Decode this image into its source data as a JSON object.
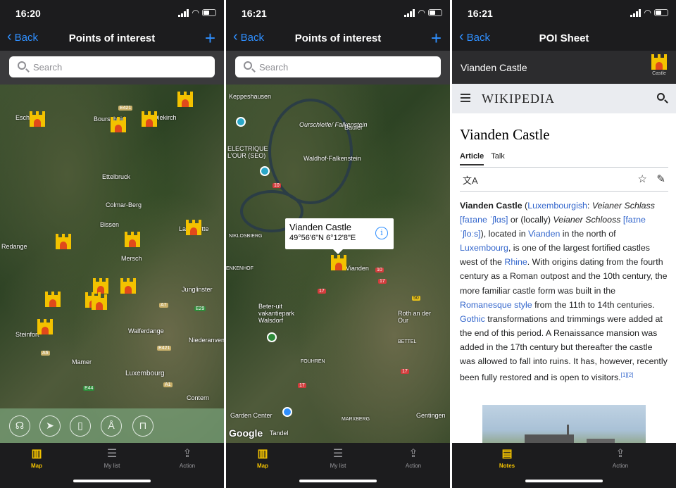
{
  "screens": [
    {
      "status_time": "16:20",
      "nav": {
        "back": "Back",
        "title": "Points of interest",
        "plus": "+"
      },
      "search_placeholder": "Search",
      "map_labels": [
        "Esch-Sure",
        "Bourscheid",
        "E421",
        "Diekirch",
        "Ettelbruck",
        "Colmar-Berg",
        "Bissen",
        "Redange",
        "Mersch",
        "Larochette",
        "Junglinster",
        "A7",
        "E29",
        "Walferdange",
        "Steinfort",
        "Niederanven",
        "A6",
        "Mamer",
        "Luxembourg",
        "E44",
        "A1",
        "Contern",
        "E421"
      ],
      "tabs": [
        {
          "label": "Map",
          "icon": "map-icon",
          "active": true
        },
        {
          "label": "My list",
          "icon": "list-icon",
          "active": false
        },
        {
          "label": "Action",
          "icon": "share-icon",
          "active": false
        }
      ]
    },
    {
      "status_time": "16:21",
      "nav": {
        "back": "Back",
        "title": "Points of interest",
        "plus": "+"
      },
      "search_placeholder": "Search",
      "callout": {
        "title": "Vianden Castle",
        "coords": "49°56'6\"N 6°12'8\"E"
      },
      "map_labels": [
        "Keppeshausen",
        "Ourschleife/ Falkenstein",
        "Bauler",
        "ELECTRIQUE L'OUR (SEO)",
        "Waldhof-Falkenstein",
        "NIKLOSBIERG",
        "ENKENHOF",
        "Vianden",
        "Beter-uit vakantiepark Walsdorf",
        "Roth an der Our",
        "BETTEL",
        "FOUHREN",
        "Garden Center",
        "Tandel",
        "MARXBERG",
        "Gentingen",
        "Google"
      ],
      "tabs": [
        {
          "label": "Map",
          "icon": "map-icon",
          "active": true
        },
        {
          "label": "My list",
          "icon": "list-icon",
          "active": false
        },
        {
          "label": "Action",
          "icon": "share-icon",
          "active": false
        }
      ]
    },
    {
      "status_time": "16:21",
      "nav": {
        "back": "Back",
        "title": "POI Sheet"
      },
      "poi": {
        "name": "Vianden Castle",
        "category": "Castle"
      },
      "wiki": {
        "logo": "WIKIPEDIA",
        "title": "Vianden Castle",
        "tabs": [
          "Article",
          "Talk"
        ],
        "body": {
          "b1": "Vianden Castle",
          "t1": " (",
          "a1": "Luxembourgish",
          "t2": ": ",
          "i1": "Veianer Schlass",
          "t3": " ",
          "a2": "[faɪane ˈʃlɑs]",
          "t4": " or (locally) ",
          "i2": "Veianer Schlooss",
          "t5": " ",
          "a3": "[faɪne ˈʃloːs]",
          "t6": "), located in ",
          "a4": "Vianden",
          "t7": " in the north of ",
          "a5": "Luxembourg",
          "t8": ", is one of the largest fortified castles west of the ",
          "a6": "Rhine",
          "t9": ". With origins dating from the fourth century as a Roman outpost and the 10th century, the more familiar castle form was built in the ",
          "a7": "Romanesque style",
          "t10": " from the 11th to 14th centuries. ",
          "a8": "Gothic",
          "t11": " transformations and trimmings were added at the end of this period. A Renaissance mansion was added in the 17th century but thereafter the castle was allowed to fall into ruins. It has, however, recently been fully restored and is open to visitors.",
          "sup": "[1][2]"
        }
      },
      "tabs": [
        {
          "label": "Notes",
          "icon": "notes-icon",
          "active": true
        },
        {
          "label": "Action",
          "icon": "share-icon",
          "active": false
        }
      ]
    }
  ],
  "colors": {
    "accent": "#2f8fff",
    "tab_active": "#f3c200",
    "castle": "#f3c200",
    "castle_door": "#e0491b"
  }
}
